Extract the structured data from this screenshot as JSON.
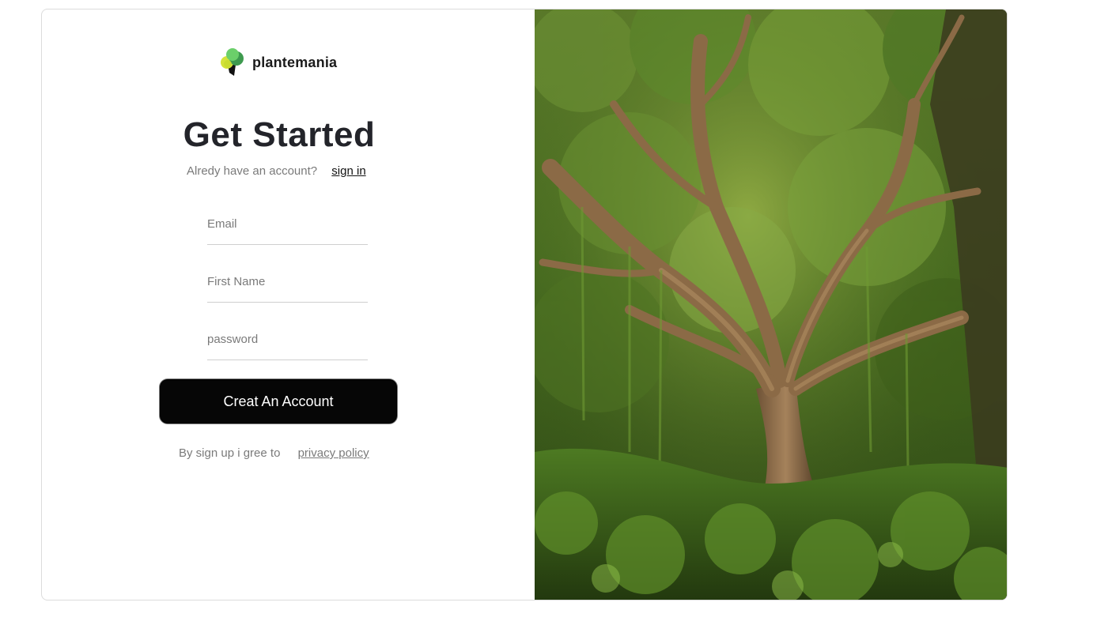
{
  "brand": {
    "name": "plantemania",
    "logo_icon": "leaf-cluster-icon",
    "logo_colors": [
      "#5fbf5a",
      "#d4e23a",
      "#111111"
    ]
  },
  "heading": {
    "title": "Get Started",
    "account_prompt": "Alredy have an account?",
    "signin_link": "sign in"
  },
  "form": {
    "email_placeholder": "Email",
    "first_name_placeholder": "First Name",
    "password_placeholder": "password",
    "submit_label": "Creat An Account"
  },
  "footer": {
    "terms_prefix": "By sign up i gree to",
    "privacy_link": "privacy policy"
  },
  "hero_image": {
    "subject": "forest-tree-photo",
    "colors": [
      "#3f5b1c",
      "#6d8a2f",
      "#8c6b4a",
      "#23310f"
    ]
  }
}
